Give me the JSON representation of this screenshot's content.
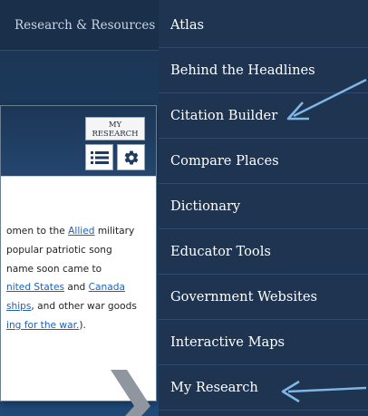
{
  "header": {
    "nav_tab": "Research & Resources"
  },
  "card": {
    "my_research_label": "MY\nRESEARCH",
    "list_icon": "list-icon",
    "gear_icon": "gear-icon",
    "body": {
      "line1": {
        "pre": "omen to the ",
        "link": "Allied",
        "post": " military"
      },
      "line2": {
        "text": " popular patriotic song"
      },
      "line3": {
        "text": "name soon came to"
      },
      "line4": {
        "link1": "nited States",
        "mid": " and ",
        "link2": "Canada"
      },
      "line5": {
        "link": "ships",
        "post": ", and other war goods"
      },
      "line6": {
        "link": "ing for the war.",
        "post": ")."
      }
    }
  },
  "menu": {
    "items": [
      "Atlas",
      "Behind the Headlines",
      "Citation Builder",
      "Compare Places",
      "Dictionary",
      "Educator Tools",
      "Government Websites",
      "Interactive Maps",
      "My Research"
    ]
  },
  "colors": {
    "menu_bg": "#1e3450",
    "arrow": "#7fb8e6",
    "link": "#1f5fb6",
    "card_header": "#1c3656"
  }
}
